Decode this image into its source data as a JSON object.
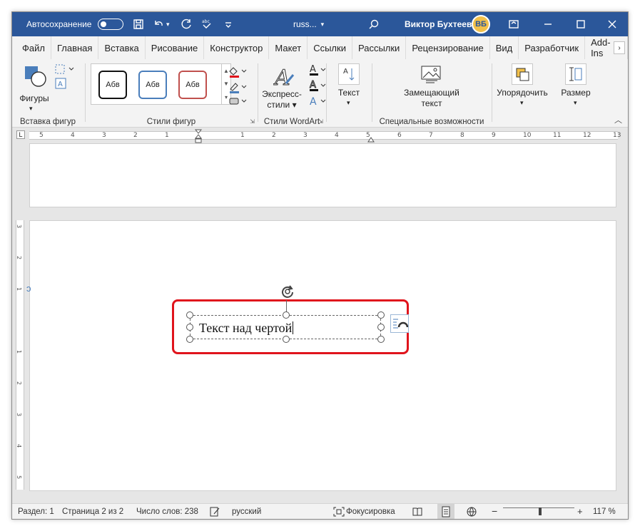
{
  "titlebar": {
    "autosave_label": "Автосохранение",
    "doc_name": "russ...",
    "user_name": "Виктор Бухтеев",
    "avatar_initials": "ВБ"
  },
  "tabs": [
    "Файл",
    "Главная",
    "Вставка",
    "Рисование",
    "Конструктор",
    "Макет",
    "Ссылки",
    "Рассылки",
    "Рецензирование",
    "Вид",
    "Разработчик",
    "Add-Ins"
  ],
  "ribbon": {
    "insert_shapes": {
      "shapes_label": "Фигуры",
      "group_label": "Вставка фигур"
    },
    "shape_styles": {
      "chip1": "Абв",
      "chip2": "Абв",
      "chip3": "Абв",
      "group_label": "Стили фигур"
    },
    "wordart": {
      "quick_styles_label_1": "Экспресс-",
      "quick_styles_label_2": "стили",
      "group_label": "Стили WordArt"
    },
    "text": {
      "label": "Текст"
    },
    "accessibility": {
      "alt_text_label_1": "Замещающий",
      "alt_text_label_2": "текст",
      "group_label": "Специальные возможности"
    },
    "arrange": {
      "label": "Упорядочить"
    },
    "size": {
      "label": "Размер"
    }
  },
  "ruler_numbers": [
    "5",
    "4",
    "3",
    "2",
    "1",
    "1",
    "2",
    "3",
    "4",
    "5",
    "6",
    "7",
    "8",
    "9",
    "10",
    "11",
    "12",
    "13"
  ],
  "vruler_numbers": [
    "3",
    "2",
    "1",
    "1",
    "2",
    "3",
    "4",
    "5"
  ],
  "document": {
    "textbox_text": "Текст над чертой"
  },
  "status": {
    "section": "Раздел: 1",
    "page": "Страница 2 из 2",
    "words": "Число слов: 238",
    "language": "русский",
    "focus": "Фокусировка",
    "zoom_minus": "−",
    "zoom_plus": "+",
    "zoom": "117 %"
  },
  "colors": {
    "titlebar": "#2b579a",
    "selection_highlight": "#e0141c",
    "style_chip_1": "#111111",
    "style_chip_2": "#4a7ebb",
    "style_chip_3": "#c0504d"
  }
}
